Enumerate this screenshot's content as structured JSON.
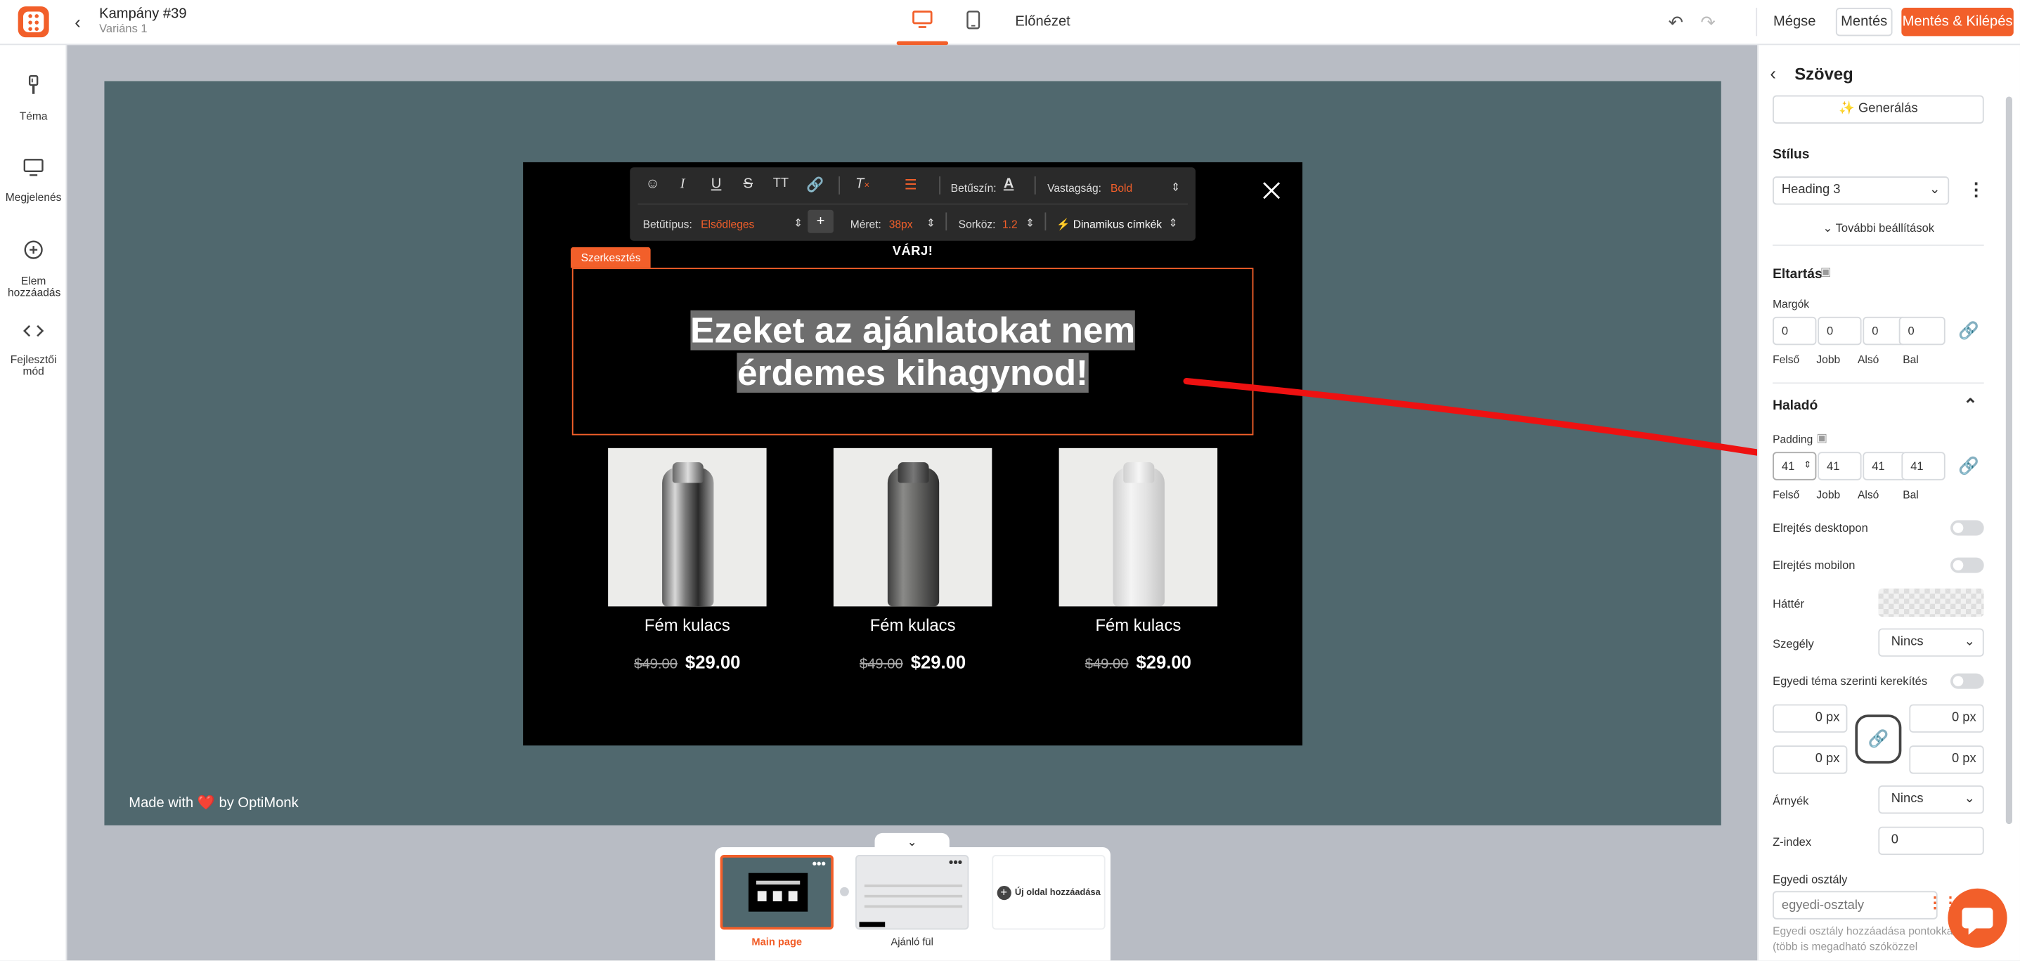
{
  "colors": {
    "accent": "#f25f2a",
    "canvas": "#50686e",
    "popup": "#000000"
  },
  "header": {
    "campaign_title": "Kampány #39",
    "variant": "Variáns 1",
    "preview": "Előnézet",
    "cancel": "Mégse",
    "save": "Mentés",
    "save_exit": "Mentés & Kilépés",
    "icons": [
      "back-icon",
      "desktop-icon",
      "mobile-icon",
      "undo-icon",
      "redo-icon"
    ]
  },
  "left_sidebar": [
    {
      "label": "Téma",
      "icon": "brush-icon"
    },
    {
      "label": "Megjelenés",
      "icon": "monitor-icon"
    },
    {
      "label": "Elem hozzáadás",
      "icon": "plus-circle-icon"
    },
    {
      "label": "Fejlesztői mód",
      "icon": "code-icon"
    }
  ],
  "toolbar": {
    "color_label": "Betűszín:",
    "weight_label": "Vastagság:",
    "weight_value": "Bold",
    "font_label": "Betűtípus:",
    "font_value": "Elsődleges",
    "size_label": "Méret:",
    "size_value": "38px",
    "line_label": "Sorköz:",
    "line_value": "1.2",
    "dynamic_label": "⚡ Dinamikus címkék",
    "plus": "+"
  },
  "popup": {
    "pretitle": "VÁRJ!",
    "edit_tag": "Szerkesztés",
    "headline_1": "Ezeket az ajánlatokat nem",
    "headline_2": "érdemes kihagynod!",
    "products": [
      {
        "name": "Fém kulacs",
        "old_price": "$49.00",
        "price": "$29.00",
        "color": "silver"
      },
      {
        "name": "Fém kulacs",
        "old_price": "$49.00",
        "price": "$29.00",
        "color": "graphite"
      },
      {
        "name": "Fém kulacs",
        "old_price": "$49.00",
        "price": "$29.00",
        "color": "white"
      }
    ]
  },
  "canvas": {
    "made_with_pre": "Made with",
    "made_with_post": "by OptiMonk"
  },
  "pages": {
    "main": "Main page",
    "second": "Ajánló fül",
    "add": "Új oldal hozzáadása"
  },
  "panel": {
    "title": "Szöveg",
    "generate": "Generálás",
    "style_heading": "Stílus",
    "style_value": "Heading 3",
    "more_settings": "További beállítások",
    "spacing_heading": "Eltartás",
    "margins_label": "Margók",
    "margins": [
      "0",
      "0",
      "0",
      "0"
    ],
    "sides": [
      "Felső",
      "Jobb",
      "Alsó",
      "Bal"
    ],
    "advanced_heading": "Haladó",
    "padding_label": "Padding",
    "padding": [
      "41",
      "41",
      "41",
      "41"
    ],
    "hide_desktop": "Elrejtés desktopon",
    "hide_mobile": "Elrejtés mobilon",
    "background": "Háttér",
    "border": "Szegély",
    "border_value": "Nincs",
    "custom_radius": "Egyedi téma szerinti kerekítés",
    "radius": [
      "0 px",
      "0 px",
      "0 px",
      "0 px"
    ],
    "shadow": "Árnyék",
    "shadow_value": "Nincs",
    "zindex": "Z-index",
    "zindex_value": "0",
    "custom_class": "Egyedi osztály",
    "custom_class_placeholder": "egyedi-osztaly",
    "custom_class_help_1": "Egyedi osztály hozzáadása pontokkal",
    "custom_class_help_2": "(több is megadható szóközzel"
  }
}
